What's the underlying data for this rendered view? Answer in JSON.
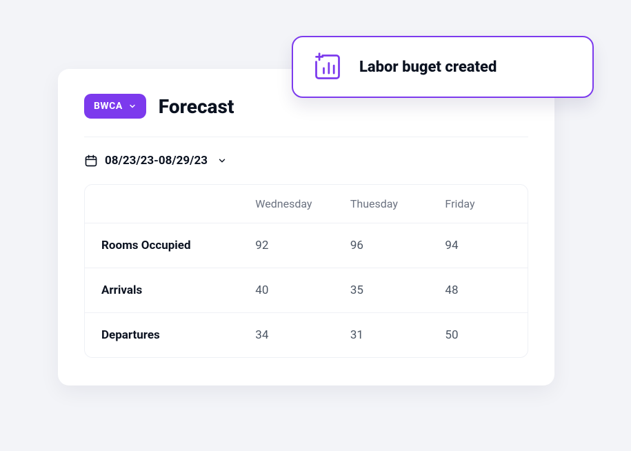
{
  "header": {
    "dropdown_label": "BWCA",
    "title": "Forecast"
  },
  "date_range": {
    "text": "08/23/23-08/29/23"
  },
  "toast": {
    "message": "Labor buget created"
  },
  "table": {
    "columns": [
      "",
      "Wednesday",
      "Thuesday",
      "Friday"
    ],
    "rows": [
      {
        "label": "Rooms Occupied",
        "values": [
          "92",
          "96",
          "94"
        ]
      },
      {
        "label": "Arrivals",
        "values": [
          "40",
          "35",
          "48"
        ]
      },
      {
        "label": "Departures",
        "values": [
          "34",
          "31",
          "50"
        ]
      }
    ]
  },
  "chart_data": {
    "type": "table",
    "columns": [
      "Wednesday",
      "Thuesday",
      "Friday"
    ],
    "series": [
      {
        "name": "Rooms Occupied",
        "values": [
          92,
          96,
          94
        ]
      },
      {
        "name": "Arrivals",
        "values": [
          40,
          35,
          48
        ]
      },
      {
        "name": "Departures",
        "values": [
          34,
          31,
          50
        ]
      }
    ],
    "title": "Forecast"
  }
}
